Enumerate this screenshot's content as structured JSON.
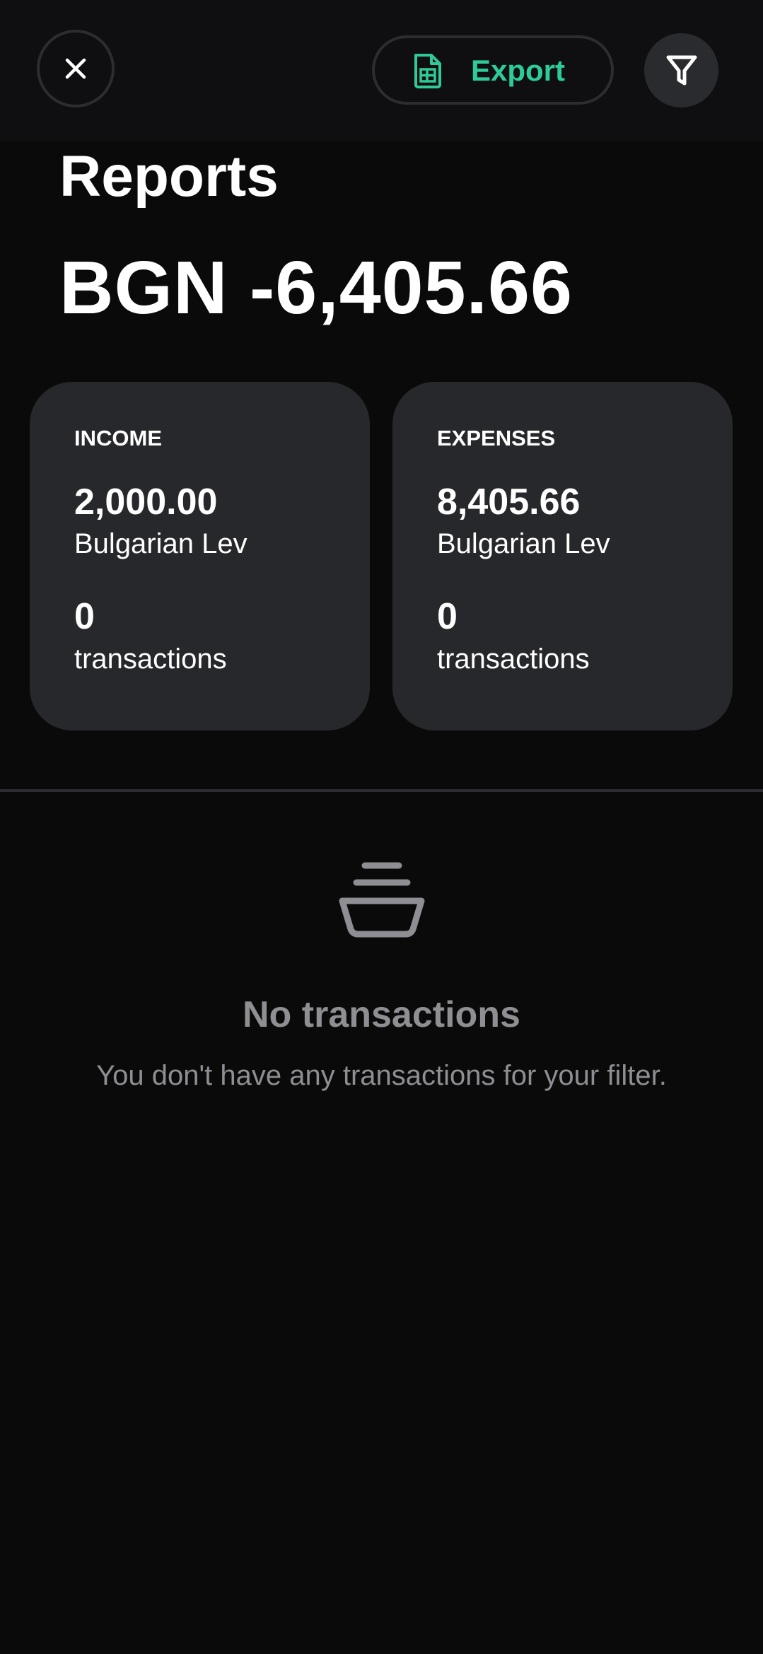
{
  "header": {
    "close_icon": "close-icon",
    "export_label": "Export",
    "export_icon": "spreadsheet-file-icon",
    "filter_icon": "filter-icon",
    "accent_color": "#2ecb98"
  },
  "title": "Reports",
  "balance": "BGN -6,405.66",
  "summary": {
    "income": {
      "label": "INCOME",
      "amount": "2,000.00",
      "currency": "Bulgarian Lev",
      "count": "0",
      "count_label": "transactions"
    },
    "expenses": {
      "label": "EXPENSES",
      "amount": "8,405.66",
      "currency": "Bulgarian Lev",
      "count": "0",
      "count_label": "transactions"
    }
  },
  "empty_state": {
    "icon": "empty-tray-icon",
    "title": "No transactions",
    "subtitle": "You don't have any transactions for your filter."
  },
  "colors": {
    "background": "#0a0a0b",
    "card": "#27282b",
    "muted_text": "#8e8e93"
  }
}
